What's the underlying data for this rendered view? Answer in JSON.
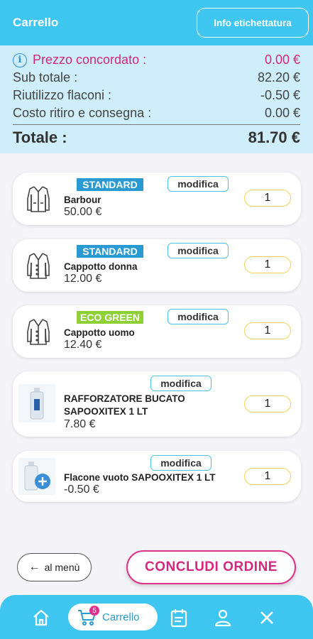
{
  "header": {
    "title": "Carrello",
    "info_label": "Info etichettatura"
  },
  "summary": {
    "agreed_price_label": "Prezzo concordato :",
    "agreed_price_value": "0.00 €",
    "subtotal_label": "Sub totale :",
    "subtotal_value": "82.20 €",
    "reuse_label": "Riutilizzo flaconi :",
    "reuse_value": "-0.50 €",
    "delivery_label": "Costo ritiro e consegna :",
    "delivery_value": "0.00 €",
    "total_label": "Totale :",
    "total_value": "81.70 €"
  },
  "items": [
    {
      "tag": "STANDARD",
      "name": "Barbour",
      "price": "50.00 €",
      "qty": "1",
      "edit": "modifica",
      "icon": "jacket-icon"
    },
    {
      "tag": "STANDARD",
      "name": "Cappotto donna",
      "price": "12.00 €",
      "qty": "1",
      "edit": "modifica",
      "icon": "coat-icon"
    },
    {
      "tag": "ECO GREEN",
      "name": "Cappotto uomo",
      "price": "12.40 €",
      "qty": "1",
      "edit": "modifica",
      "icon": "coat-icon"
    },
    {
      "tag": "",
      "name_line1": "RAFFORZATORE BUCATO",
      "name_line2": "SAPOOXITEX 1 LT",
      "price": "7.80 €",
      "qty": "1",
      "edit": "modifica",
      "icon": "bottle-icon"
    },
    {
      "tag": "",
      "name": "Flacone vuoto SAPOOXITEX 1 LT",
      "price": "-0.50 €",
      "qty": "1",
      "edit": "modifica",
      "icon": "empty-bottle-icon"
    }
  ],
  "actions": {
    "back_label": "al menù",
    "conclude_label": "CONCLUDI ORDINE"
  },
  "nav": {
    "cart_label": "Carrello",
    "cart_badge": "5"
  },
  "colors": {
    "primary": "#3ec6f1",
    "accent": "#d6267f",
    "standard_tag": "#2a9ad2",
    "eco_tag": "#8ed136"
  }
}
